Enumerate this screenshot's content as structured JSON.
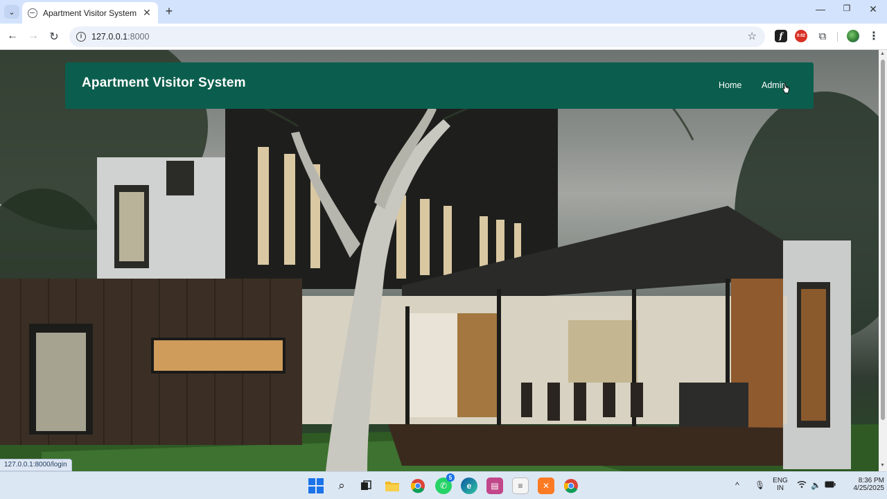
{
  "browser": {
    "tab_title": "Apartment Visitor System",
    "tab_close": "✕",
    "new_tab": "+",
    "url_host": "127.0.0.1",
    "url_port": ":8000",
    "back": "←",
    "forward": "→",
    "reload": "↻",
    "star": "☆",
    "ext_f": "f",
    "ext_rec_timer": "0:02",
    "ext_puzzle": "⧉",
    "menu": "⋮",
    "minimize": "—",
    "maximize": "❐",
    "close": "✕",
    "tab_search": "⌄"
  },
  "site": {
    "brand": "Apartment Visitor System",
    "nav": [
      "Home",
      "Admin"
    ]
  },
  "status_url": "127.0.0.1:8000/login",
  "taskbar": {
    "whatsapp_badge": "5",
    "lang_top": "ENG",
    "lang_bottom": "IN",
    "time": "8:36 PM",
    "date": "4/25/2025",
    "chevron": "^"
  },
  "colors": {
    "nav_bg": "#0b5e4d",
    "tabstrip": "#d3e3fd"
  }
}
